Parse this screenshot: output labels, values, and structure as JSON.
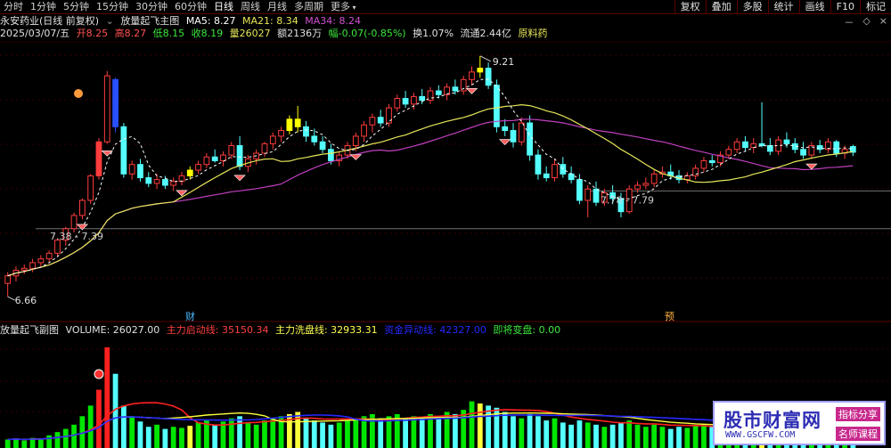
{
  "toolbar": {
    "timeframes": [
      {
        "label": "分时",
        "active": false
      },
      {
        "label": "1分钟",
        "active": false
      },
      {
        "label": "5分钟",
        "active": false
      },
      {
        "label": "15分钟",
        "active": false
      },
      {
        "label": "30分钟",
        "active": false
      },
      {
        "label": "60分钟",
        "active": false
      },
      {
        "label": "日线",
        "active": true
      },
      {
        "label": "周线",
        "active": false
      },
      {
        "label": "月线",
        "active": false
      },
      {
        "label": "多周期",
        "active": false
      },
      {
        "label": "更多",
        "active": false
      }
    ],
    "right_buttons": [
      "复权",
      "叠加",
      "多股",
      "统计",
      "画线",
      "F10",
      "标记"
    ],
    "window_controls": [
      "－",
      "◇",
      "×"
    ]
  },
  "header": {
    "stock_name": "永安药业(日线 前复权)",
    "indicator_name": "放量起飞主图",
    "ma5": "MA5: 8.27",
    "ma21": "MA21: 8.34",
    "ma34": "MA34: 8.24",
    "date": "2025/03/07/五",
    "open": "开8.25",
    "high": "高8.27",
    "low": "低8.15",
    "close": "收8.19",
    "volume": "量26027",
    "amount": "额2136万",
    "change": "幅-0.07(-0.85%)",
    "turnover": "换1.07%",
    "float": "流通2.44亿",
    "industry": "原料药"
  },
  "colors": {
    "up": "#ff3c3c",
    "down": "#54ffff",
    "ma5": "#ffffff",
    "ma21": "#e6e65a",
    "ma34": "#c040c0",
    "level": "#707070",
    "vol_green": "#00e600",
    "vol_yellow": "#ffff3c",
    "vol_blue": "#2828ff",
    "vol_red": "#ff2020"
  },
  "sub": {
    "title": "放量起飞副图",
    "volume": "VOLUME: 26027.00",
    "line1": "主力启动线: 35150.34",
    "line2": "主力洗盘线: 32933.31",
    "line3": "资金异动线: 42327.00",
    "line4": "即将变盘: 0.00"
  },
  "watermark": {
    "main": "股市财富网",
    "url": "WWW.GSCFW.COM",
    "tag1": "指标分享",
    "tag2": "名师课程"
  },
  "chart_data": {
    "type": "candlestick",
    "annotations": {
      "high_label": "9.21",
      "low_label": "6.66",
      "range1": "7.38 - 7.39",
      "range2": "7.78 - 7.79",
      "marker1": "财",
      "marker2": "预"
    },
    "price_range": [
      6.5,
      9.35
    ],
    "levels": [
      7.38,
      7.78
    ],
    "candles": [
      [
        6.8,
        6.92,
        6.66,
        6.88
      ],
      [
        6.88,
        6.98,
        6.82,
        6.94
      ],
      [
        6.94,
        7.0,
        6.9,
        6.96
      ],
      [
        6.96,
        7.06,
        6.92,
        7.02
      ],
      [
        7.02,
        7.1,
        6.98,
        7.06
      ],
      [
        7.06,
        7.15,
        7.02,
        7.12
      ],
      [
        7.12,
        7.28,
        7.08,
        7.26
      ],
      [
        7.26,
        7.4,
        7.2,
        7.38
      ],
      [
        7.38,
        7.55,
        7.34,
        7.52
      ],
      [
        7.52,
        7.7,
        7.48,
        7.68
      ],
      [
        7.68,
        7.96,
        7.64,
        7.94
      ],
      [
        7.94,
        8.34,
        7.9,
        8.3
      ],
      [
        8.3,
        9.05,
        8.28,
        9.0
      ],
      [
        8.96,
        8.98,
        8.4,
        8.46
      ],
      [
        8.46,
        8.5,
        7.92,
        7.96
      ],
      [
        7.96,
        8.1,
        7.9,
        8.06
      ],
      [
        8.06,
        8.12,
        7.88,
        7.92
      ],
      [
        7.92,
        7.98,
        7.82,
        7.86
      ],
      [
        7.86,
        7.96,
        7.8,
        7.9
      ],
      [
        7.9,
        7.94,
        7.8,
        7.84
      ],
      [
        7.84,
        7.92,
        7.78,
        7.88
      ],
      [
        7.88,
        7.98,
        7.84,
        7.94
      ],
      [
        7.94,
        8.04,
        7.9,
        8.0
      ],
      [
        8.0,
        8.1,
        7.96,
        8.06
      ],
      [
        8.06,
        8.18,
        8.02,
        8.14
      ],
      [
        8.14,
        8.22,
        8.08,
        8.1
      ],
      [
        8.1,
        8.2,
        8.04,
        8.16
      ],
      [
        8.16,
        8.3,
        8.12,
        8.26
      ],
      [
        8.26,
        8.36,
        8.0,
        8.04
      ],
      [
        8.04,
        8.16,
        7.98,
        8.12
      ],
      [
        8.12,
        8.22,
        8.06,
        8.18
      ],
      [
        8.18,
        8.3,
        8.14,
        8.28
      ],
      [
        8.28,
        8.4,
        8.22,
        8.36
      ],
      [
        8.36,
        8.46,
        8.3,
        8.42
      ],
      [
        8.42,
        8.58,
        8.38,
        8.54
      ],
      [
        8.54,
        8.68,
        8.4,
        8.46
      ],
      [
        8.46,
        8.52,
        8.3,
        8.36
      ],
      [
        8.36,
        8.44,
        8.26,
        8.3
      ],
      [
        8.3,
        8.36,
        8.18,
        8.22
      ],
      [
        8.22,
        8.28,
        8.06,
        8.1
      ],
      [
        8.1,
        8.2,
        8.04,
        8.16
      ],
      [
        8.16,
        8.3,
        8.12,
        8.26
      ],
      [
        8.26,
        8.4,
        8.2,
        8.36
      ],
      [
        8.36,
        8.52,
        8.3,
        8.48
      ],
      [
        8.48,
        8.6,
        8.4,
        8.56
      ],
      [
        8.56,
        8.64,
        8.46,
        8.5
      ],
      [
        8.5,
        8.7,
        8.46,
        8.66
      ],
      [
        8.66,
        8.8,
        8.62,
        8.76
      ],
      [
        8.76,
        8.84,
        8.66,
        8.7
      ],
      [
        8.7,
        8.82,
        8.64,
        8.78
      ],
      [
        8.78,
        8.86,
        8.7,
        8.74
      ],
      [
        8.74,
        8.88,
        8.7,
        8.84
      ],
      [
        8.84,
        8.9,
        8.76,
        8.8
      ],
      [
        8.8,
        8.92,
        8.74,
        8.88
      ],
      [
        8.88,
        8.96,
        8.8,
        8.84
      ],
      [
        8.84,
        9.0,
        8.8,
        8.96
      ],
      [
        8.96,
        9.1,
        8.9,
        9.04
      ],
      [
        9.04,
        9.21,
        8.98,
        9.08
      ],
      [
        9.08,
        9.14,
        8.86,
        8.9
      ],
      [
        8.9,
        8.96,
        8.4,
        8.46
      ],
      [
        8.46,
        8.54,
        8.36,
        8.42
      ],
      [
        8.42,
        8.5,
        8.24,
        8.3
      ],
      [
        8.3,
        8.56,
        8.26,
        8.5
      ],
      [
        8.5,
        8.58,
        8.1,
        8.16
      ],
      [
        8.16,
        8.22,
        7.9,
        7.96
      ],
      [
        7.96,
        8.04,
        7.88,
        7.92
      ],
      [
        7.92,
        8.12,
        7.88,
        8.06
      ],
      [
        8.06,
        8.14,
        7.92,
        7.96
      ],
      [
        7.96,
        8.04,
        7.86,
        7.9
      ],
      [
        7.9,
        7.96,
        7.64,
        7.68
      ],
      [
        7.68,
        7.84,
        7.5,
        7.8
      ],
      [
        7.8,
        7.88,
        7.62,
        7.66
      ],
      [
        7.66,
        7.8,
        7.62,
        7.76
      ],
      [
        7.76,
        7.84,
        7.64,
        7.7
      ],
      [
        7.7,
        7.76,
        7.5,
        7.56
      ],
      [
        7.56,
        7.84,
        7.54,
        7.8
      ],
      [
        7.8,
        7.88,
        7.76,
        7.84
      ],
      [
        7.84,
        7.92,
        7.8,
        7.86
      ],
      [
        7.86,
        8.0,
        7.82,
        7.96
      ],
      [
        7.96,
        8.04,
        7.92,
        7.98
      ],
      [
        7.98,
        8.06,
        7.9,
        7.94
      ],
      [
        7.94,
        8.0,
        7.86,
        7.9
      ],
      [
        7.9,
        7.98,
        7.86,
        7.94
      ],
      [
        7.94,
        8.06,
        7.9,
        8.02
      ],
      [
        8.02,
        8.14,
        7.98,
        8.1
      ],
      [
        8.1,
        8.16,
        8.04,
        8.08
      ],
      [
        8.08,
        8.2,
        8.04,
        8.16
      ],
      [
        8.16,
        8.26,
        8.12,
        8.22
      ],
      [
        8.22,
        8.34,
        8.18,
        8.3
      ],
      [
        8.3,
        8.36,
        8.2,
        8.24
      ],
      [
        8.24,
        8.34,
        8.18,
        8.28
      ],
      [
        8.28,
        8.72,
        8.24,
        8.26
      ],
      [
        8.26,
        8.34,
        8.16,
        8.2
      ],
      [
        8.2,
        8.36,
        8.16,
        8.32
      ],
      [
        8.32,
        8.4,
        8.24,
        8.28
      ],
      [
        8.28,
        8.34,
        8.18,
        8.22
      ],
      [
        8.22,
        8.3,
        8.12,
        8.16
      ],
      [
        8.16,
        8.3,
        8.12,
        8.26
      ],
      [
        8.26,
        8.32,
        8.18,
        8.22
      ],
      [
        8.22,
        8.34,
        8.18,
        8.3
      ],
      [
        8.3,
        8.32,
        8.14,
        8.18
      ],
      [
        8.18,
        8.26,
        8.12,
        8.22
      ],
      [
        8.25,
        8.27,
        8.15,
        8.19
      ]
    ],
    "volume_max": 100000,
    "volume": [
      8000,
      9000,
      7000,
      9500,
      8800,
      12000,
      15000,
      18000,
      22000,
      30000,
      40000,
      55000,
      95000,
      70000,
      40000,
      30000,
      25000,
      20000,
      22000,
      18000,
      20000,
      19000,
      21000,
      24000,
      26000,
      22000,
      25000,
      28000,
      30000,
      24000,
      22000,
      26000,
      28000,
      30000,
      32000,
      34000,
      28000,
      26000,
      24000,
      22000,
      24000,
      26000,
      28000,
      30000,
      32000,
      28000,
      30000,
      32000,
      28000,
      30000,
      28000,
      32000,
      30000,
      34000,
      32000,
      36000,
      44000,
      42000,
      40000,
      38000,
      34000,
      30000,
      28000,
      32000,
      30000,
      26000,
      28000,
      24000,
      22000,
      26000,
      24000,
      22000,
      20000,
      22000,
      24000,
      26000,
      22000,
      20000,
      22000,
      20000,
      18000,
      20000,
      19000,
      21000,
      22000,
      20000,
      22000,
      24000,
      26000,
      22000,
      24000,
      36000,
      28000,
      26000,
      24000,
      22000,
      20000,
      22000,
      21000,
      23000,
      20000,
      22000,
      26027
    ]
  }
}
